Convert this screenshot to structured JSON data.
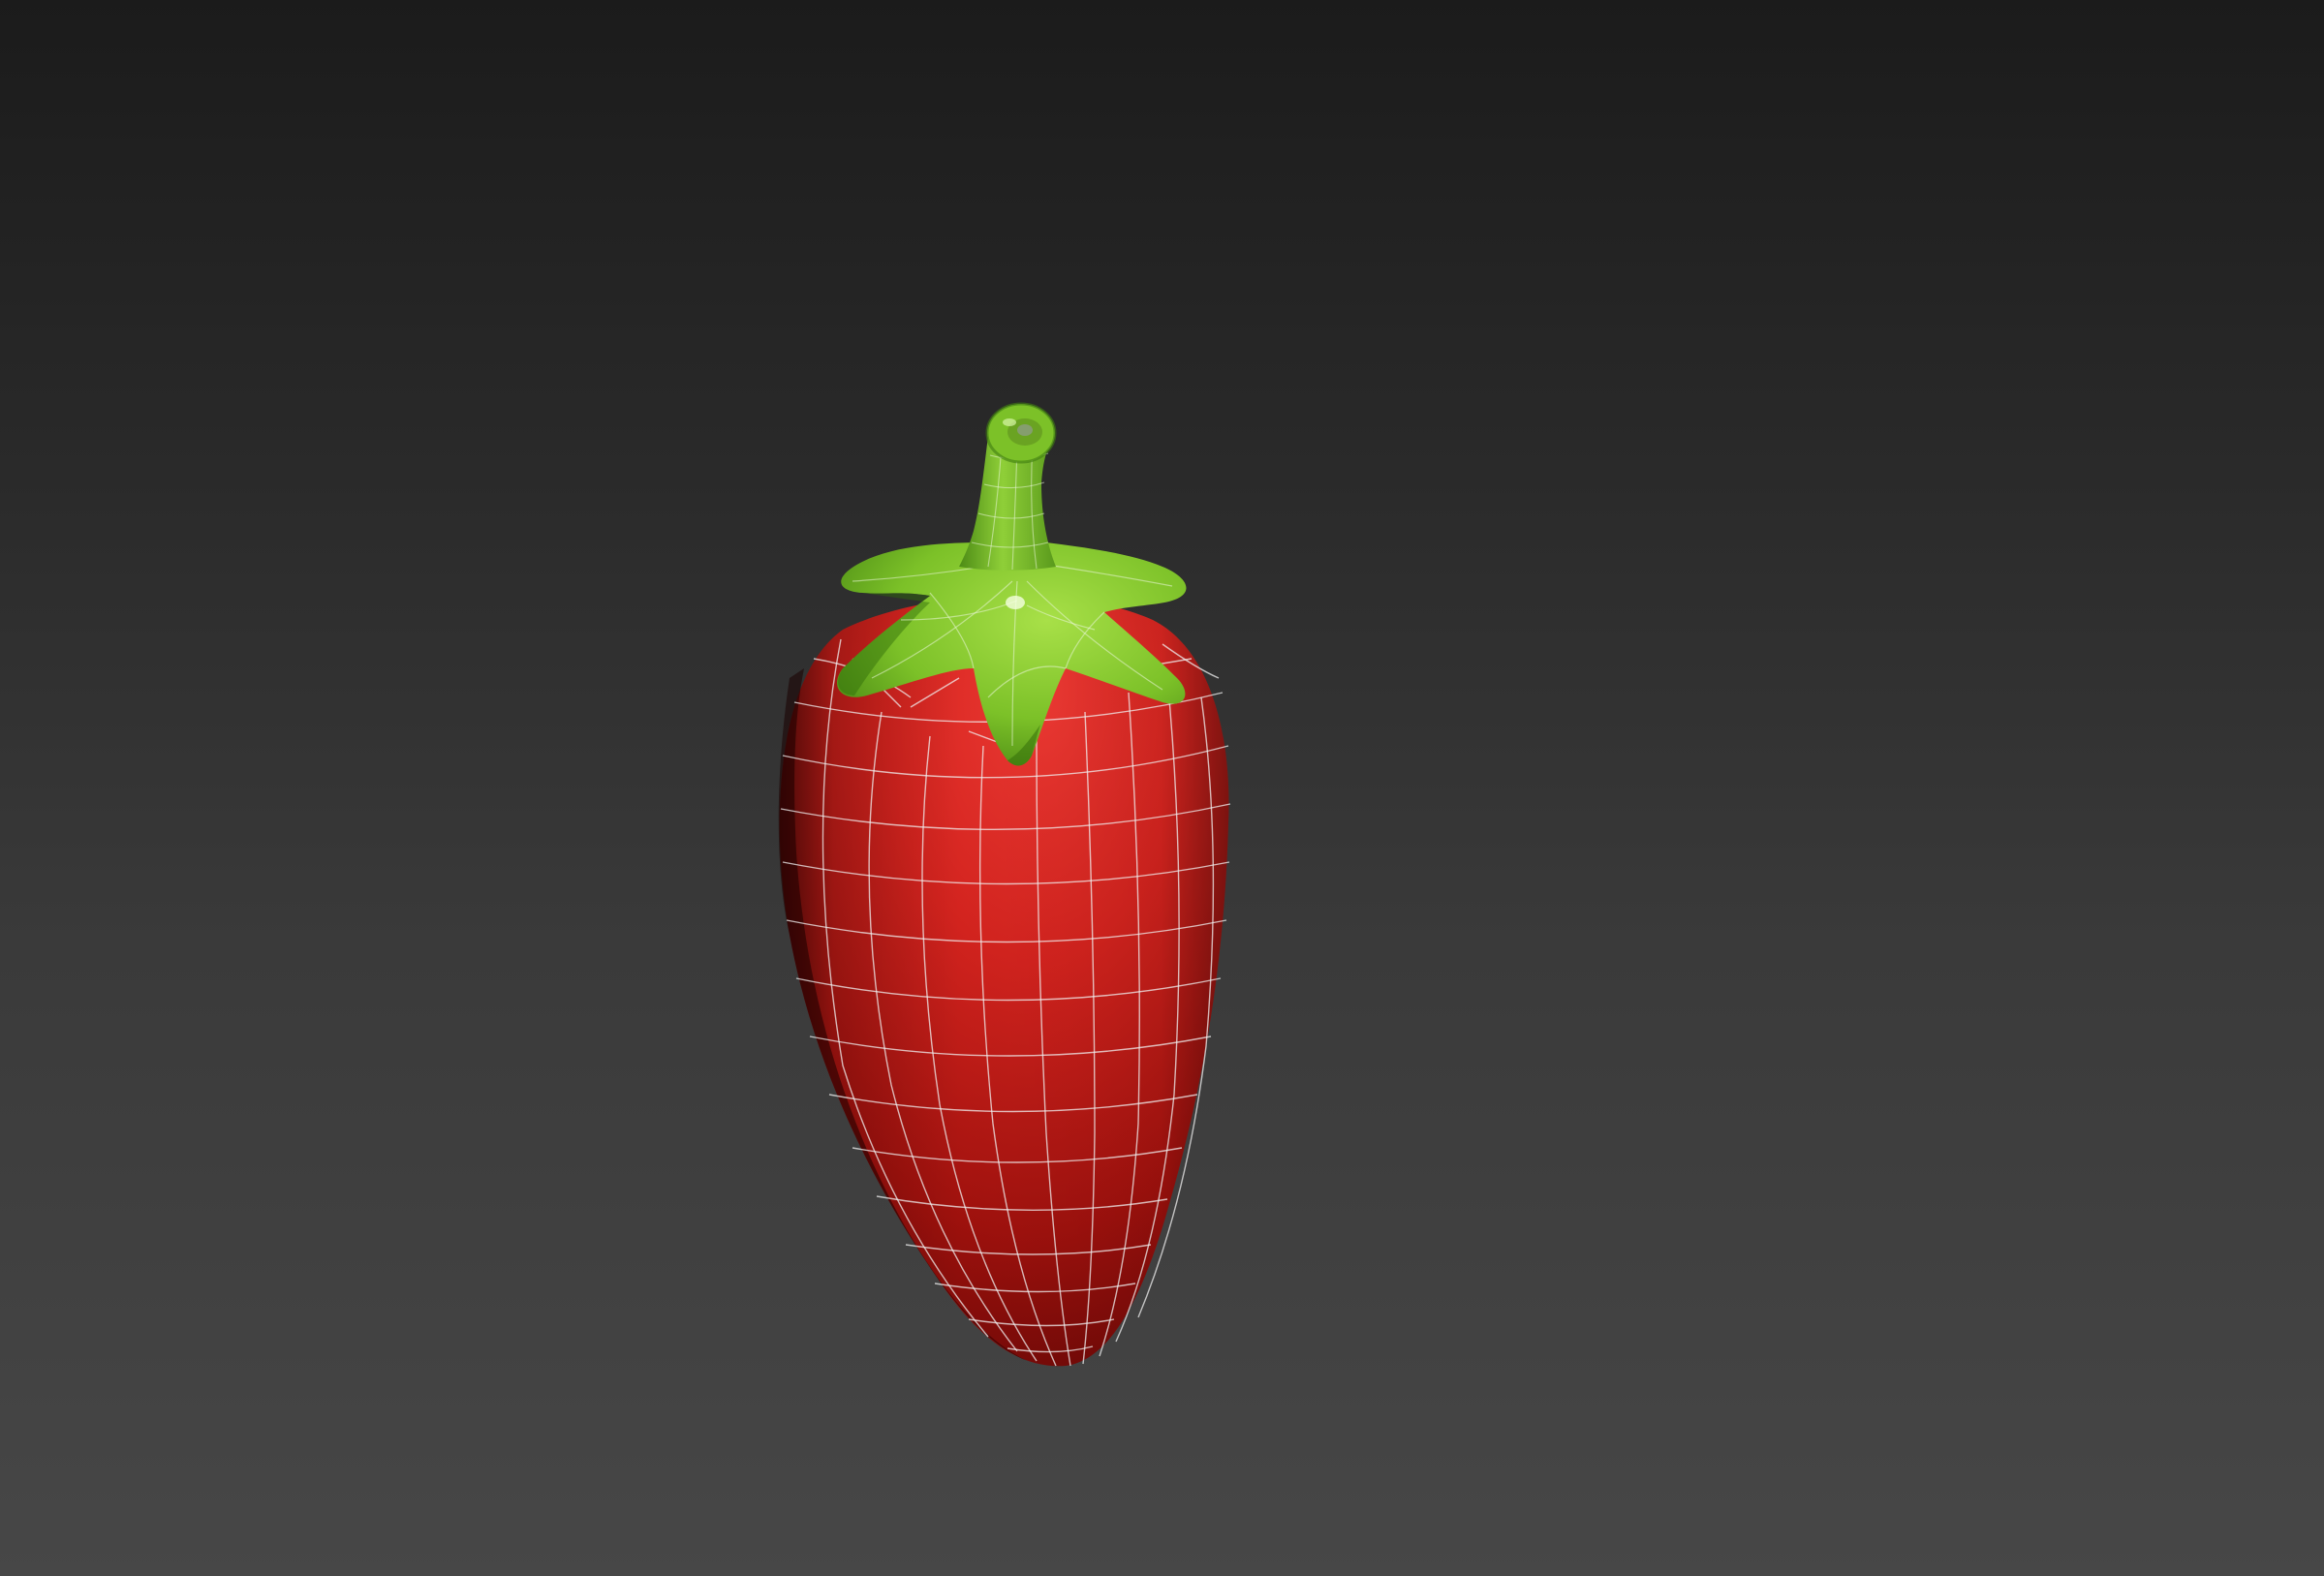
{
  "viewport": {
    "background_top": "#1b1b1b",
    "background_bottom": "#474747"
  },
  "model": {
    "name": "pepper-model",
    "body_color_light": "#e8302c",
    "body_color_mid": "#c41d18",
    "body_color_dark": "#6d0705",
    "stem_color_light": "#9ad43a",
    "stem_color_dark": "#3f7d10",
    "wireframe_color": "#f0f0f0",
    "display_mode": "smooth-shaded-with-wireframe"
  }
}
